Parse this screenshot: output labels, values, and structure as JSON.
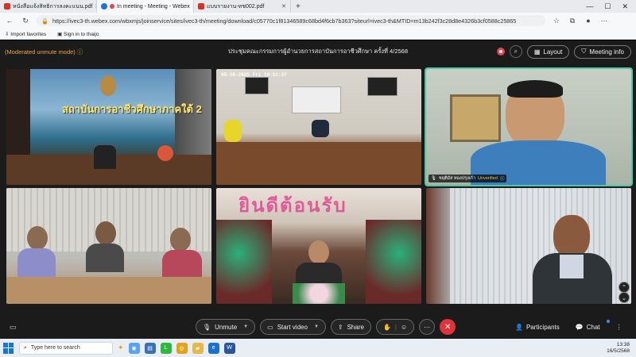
{
  "browser": {
    "tabs": [
      {
        "label": "หนังสือแจ้งสิทธิการลงคะแนน.pdf",
        "color": "#d93025",
        "active": false
      },
      {
        "label": "In meeting - Meeting - Webex",
        "color": "#1a73e8",
        "active": true
      },
      {
        "label": "แบบรายงาน-ทช002.pdf",
        "color": "#d93025",
        "active": false
      }
    ],
    "url": "https://ivec3-th.webex.com/wbxmjs/joinservice/sites/ivec3-th/meeting/download/c05770c1f81346589c68bd4f6cb7b363?siteurl=ivec3-th&MTID=m13b242f3c28d8e4326b3cf0588c25865",
    "bookmarks": [
      "Import favorites",
      "Sign in to thaijo"
    ]
  },
  "webex": {
    "moderated_label": "(Moderated unmute mode)",
    "meeting_title": "ประชุมคณะกรรมการผู้อำนวยการสถาบันการอาชีวศึกษา ครั้งที่ 4/2568",
    "layout_label": "Layout",
    "meeting_info_label": "Meeting info",
    "tiles": [
      {
        "banner": "สถาบันการอาชีวศึกษาภาคใต้ 2",
        "name": ""
      },
      {
        "banner": "05-16-2025 Fri 10:51:27",
        "name": ""
      },
      {
        "banner": "",
        "name": "ชยุติมัส ทองปรุงเก้า",
        "status": "Unverified"
      },
      {
        "banner": "",
        "name": ""
      },
      {
        "banner": "ยินดีต้อนรับ",
        "name": ""
      },
      {
        "banner": "",
        "name": ""
      }
    ],
    "controls": {
      "unmute": "Unmute",
      "start_video": "Start video",
      "share": "Share",
      "participants": "Participants",
      "chat": "Chat"
    }
  },
  "taskbar": {
    "search_placeholder": "Type here to search",
    "time": "13:38",
    "date": "16/5/2568"
  }
}
